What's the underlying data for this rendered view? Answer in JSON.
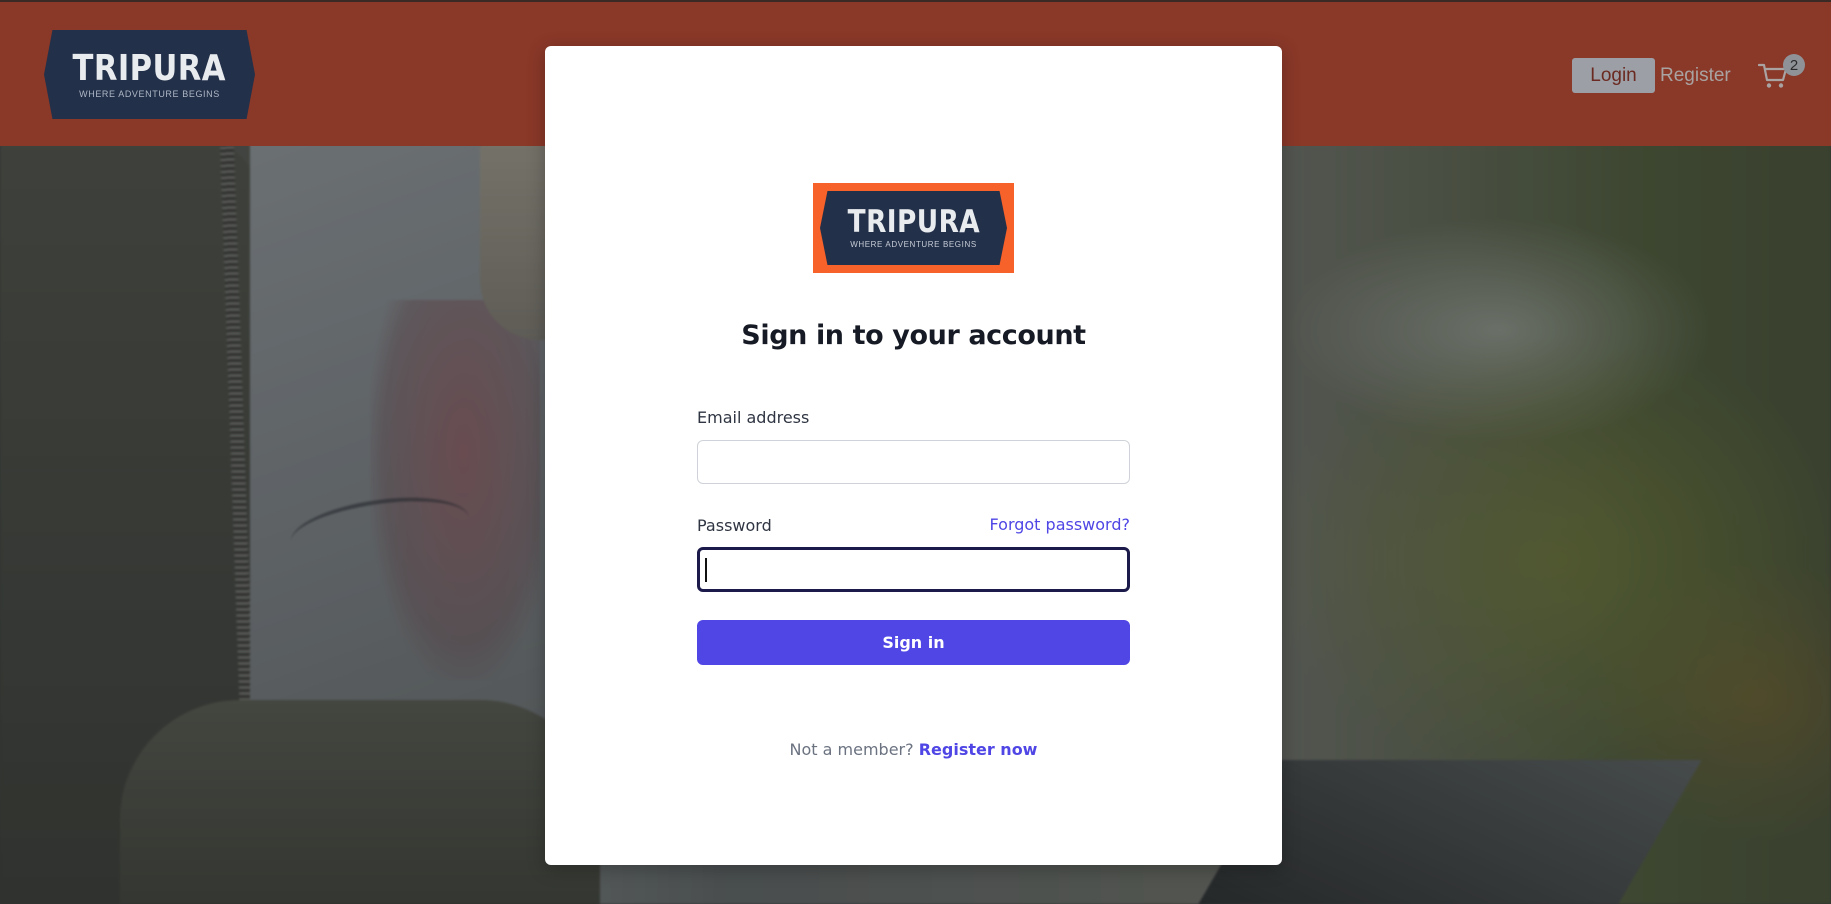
{
  "brand": {
    "name": "TRIPURA",
    "tagline": "WHERE ADVENTURE BEGINS"
  },
  "header": {
    "login_label": "Login",
    "register_label": "Register",
    "cart_count": "2",
    "cart_icon": "cart-icon"
  },
  "login_form": {
    "title": "Sign in to your account",
    "email_label": "Email address",
    "email_value": "",
    "password_label": "Password",
    "password_value": "",
    "forgot_password_label": "Forgot password?",
    "submit_label": "Sign in",
    "not_member_text": "Not a member?",
    "register_now_label": "Register now"
  },
  "colors": {
    "header_bg": "#8a3828",
    "logo_bg": "#233049",
    "logo_frame": "#f7612a",
    "accent": "#4f46e5",
    "card_bg": "#ffffff"
  }
}
